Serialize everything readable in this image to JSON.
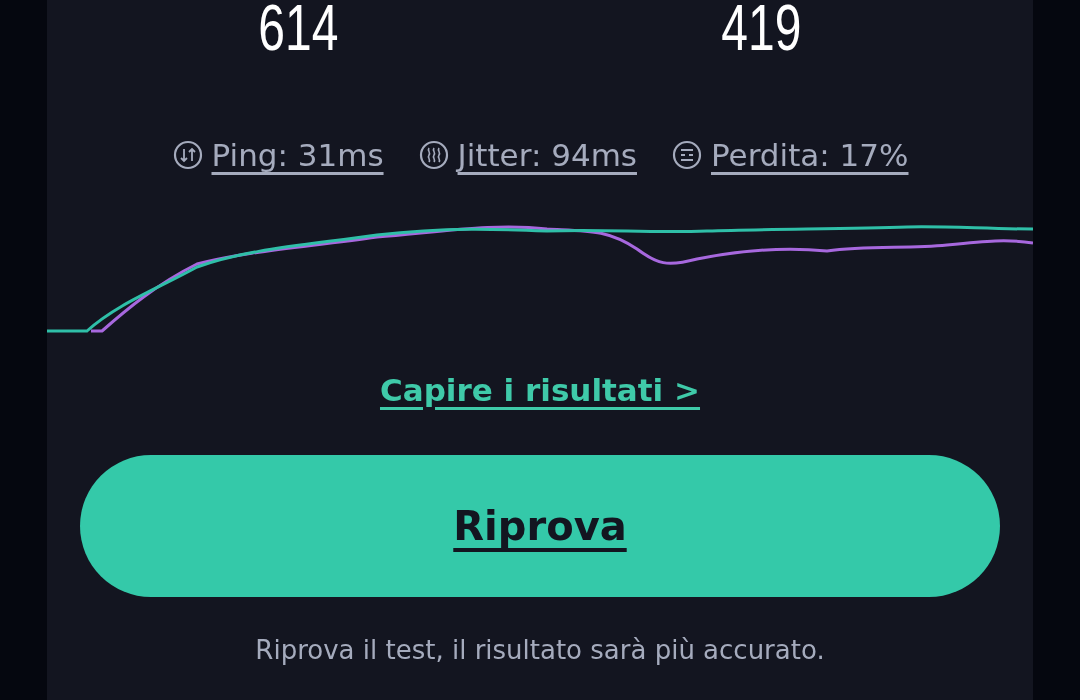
{
  "results": [
    {
      "value": "614"
    },
    {
      "value": "419"
    }
  ],
  "stats": [
    {
      "kind": "ping",
      "label": "Ping: 31ms"
    },
    {
      "kind": "jitter",
      "label": "Jitter: 94ms"
    },
    {
      "kind": "loss",
      "label": "Perdita: 17%"
    }
  ],
  "link": "Capire i risultati >",
  "button": "Riprova",
  "caption": "Riprova il test, il risultato sarà più accurato."
}
